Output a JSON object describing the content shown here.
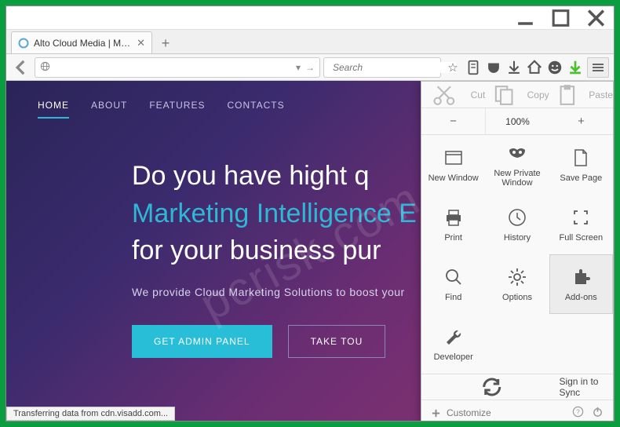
{
  "tab": {
    "title": "Alto Cloud Media | Market..."
  },
  "searchbar": {
    "placeholder": "Search"
  },
  "editrow": {
    "cut": "Cut",
    "copy": "Copy",
    "paste": "Paste"
  },
  "zoom": {
    "value": "100%"
  },
  "menu": {
    "items": [
      {
        "label": "New Window"
      },
      {
        "label": "New Private Window"
      },
      {
        "label": "Save Page"
      },
      {
        "label": "Print"
      },
      {
        "label": "History"
      },
      {
        "label": "Full Screen"
      },
      {
        "label": "Find"
      },
      {
        "label": "Options"
      },
      {
        "label": "Add-ons"
      },
      {
        "label": "Developer"
      }
    ],
    "sync": "Sign in to Sync",
    "customize": "Customize"
  },
  "nav": {
    "home": "HOME",
    "about": "ABOUT",
    "features": "FEATURES",
    "contacts": "CONTACTS"
  },
  "hero": {
    "l1": "Do you have hight q",
    "l2": "Marketing Intelligence E",
    "l3": "for your business pur",
    "sub": "We provide Cloud Marketing Solutions to boost your",
    "btn1": "GET ADMIN PANEL",
    "btn2": "TAKE TOU"
  },
  "status": "Transferring data from cdn.visadd.com...",
  "watermark": "pcrisk.com"
}
